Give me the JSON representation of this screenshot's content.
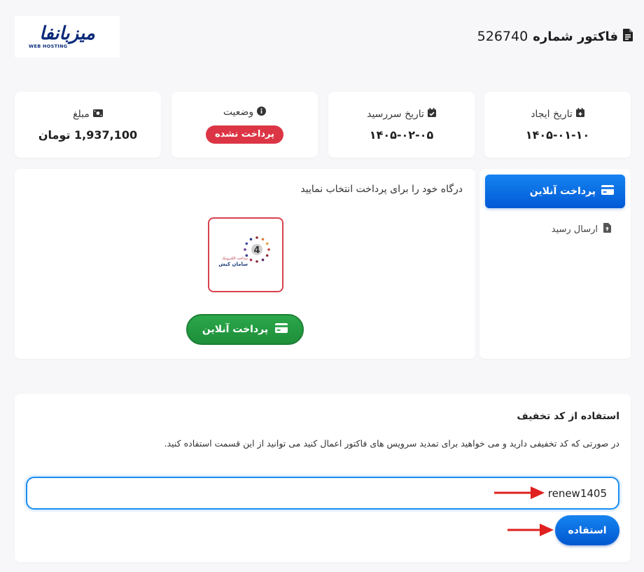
{
  "header": {
    "title": "فاکتور شماره",
    "invoice_number": "526740",
    "logo_text": "میزبانفا",
    "logo_sub": "WEB HOSTING"
  },
  "info_cards": {
    "created": {
      "label": "تاریخ ایجاد",
      "value": "۱۴۰۵-۰۱-۱۰"
    },
    "due": {
      "label": "تاریخ سررسید",
      "value": "۱۴۰۵-۰۲-۰۵"
    },
    "status": {
      "label": "وضعیت",
      "value": "پرداخت نشده",
      "color": "#dc3545"
    },
    "amount": {
      "label": "مبلغ",
      "value": "1,937,100 تومان"
    }
  },
  "side_tabs": [
    {
      "label": "پرداخت آنلاین",
      "active": true,
      "icon": "credit-card-icon"
    },
    {
      "label": "ارسال رسید",
      "active": false,
      "icon": "file-upload-icon"
    }
  ],
  "gateway": {
    "title": "درگاه خود را برای پرداخت انتخاب نمایید",
    "pay_button": "پرداخت آنلاین",
    "logo_lines": [
      "پرداخت الکترونیک",
      "سامان کیش"
    ]
  },
  "discount": {
    "title": "استفاده از کد تخفیف",
    "description": "در صورتی که کد تخفیفی دارید و می خواهید برای تمدید سرویس های فاکتور اعمال کنید می توانید از این قسمت استفاده کنید.",
    "input_value": "renew1405",
    "apply_button": "استفاده"
  },
  "colors": {
    "primary": "#0a6fe6",
    "success": "#28a745",
    "danger": "#dc3545",
    "annotation_arrow": "#e02020"
  }
}
